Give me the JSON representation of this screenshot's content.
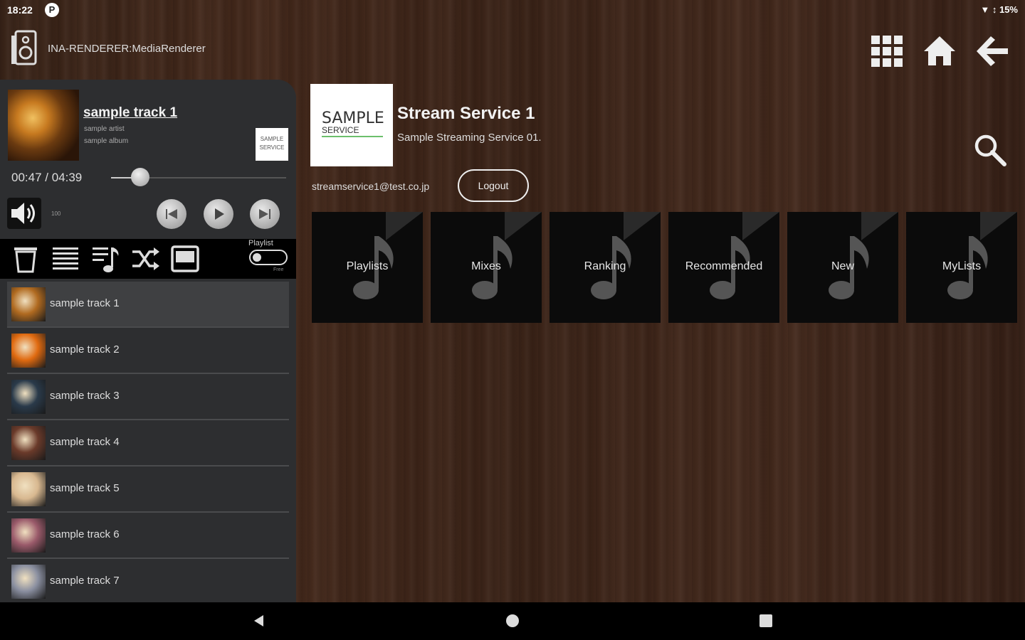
{
  "status_bar": {
    "time": "18:22",
    "notification_icon": "P",
    "system_icons_text": "15%",
    "icons": [
      "wifi-icon",
      "signal-icon",
      "battery-icon"
    ]
  },
  "header": {
    "renderer_name": "INA-RENDERER:MediaRenderer",
    "buttons": [
      "grid-icon",
      "home-icon",
      "back-arrow-icon"
    ]
  },
  "now_playing": {
    "title": "sample track 1",
    "artist": "sample artist",
    "album": "sample album",
    "service_thumb_text": "SAMPLE SERVICE",
    "time": "00:47 / 04:39",
    "progress_fraction": 0.168,
    "volume_value": "100"
  },
  "controls": [
    "previous-icon",
    "play-icon",
    "next-icon"
  ],
  "toolbar": {
    "icons": [
      "trash-icon",
      "list-icon",
      "music-list-icon",
      "shuffle-icon",
      "screen-icon"
    ],
    "playlist_label": "Playlist",
    "playlist_sub": "Free"
  },
  "tracks": [
    {
      "title": "sample track 1",
      "color": "#b06a20",
      "selected": true
    },
    {
      "title": "sample track 2",
      "color": "#e06a10",
      "selected": false
    },
    {
      "title": "sample track 3",
      "color": "#2a3a4a",
      "selected": false
    },
    {
      "title": "sample track 4",
      "color": "#6a3a2a",
      "selected": false
    },
    {
      "title": "sample track 5",
      "color": "#d8b890",
      "selected": false
    },
    {
      "title": "sample track 6",
      "color": "#9a5a6a",
      "selected": false
    },
    {
      "title": "sample track 7",
      "color": "#8a8fa0",
      "selected": false
    }
  ],
  "service": {
    "logo_line1": "SAMPLE",
    "logo_line2": "SERVICE",
    "name": "Stream Service 1",
    "description": "Sample Streaming Service 01.",
    "email": "streamservice1@test.co.jp",
    "logout_label": "Logout"
  },
  "categories": [
    {
      "label": "Playlists"
    },
    {
      "label": "Mixes"
    },
    {
      "label": "Ranking"
    },
    {
      "label": "Recommended"
    },
    {
      "label": "New"
    },
    {
      "label": "MyLists"
    }
  ],
  "colors": {
    "panel": "#2d2e30",
    "tile": "#0b0b0b",
    "wood": "#3f2619"
  },
  "nav_bar": [
    "nav-back-icon",
    "nav-home-icon",
    "nav-recents-icon"
  ]
}
